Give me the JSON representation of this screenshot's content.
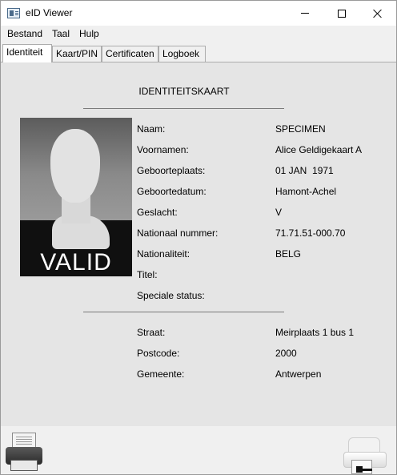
{
  "window": {
    "title": "eID Viewer",
    "controls": {
      "minimize": "minimize-icon",
      "maximize": "maximize-icon",
      "close": "close-icon"
    }
  },
  "menu": {
    "items": [
      {
        "label": "Bestand"
      },
      {
        "label": "Taal"
      },
      {
        "label": "Hulp"
      }
    ]
  },
  "tabs": [
    {
      "label": "Identiteit",
      "active": true
    },
    {
      "label": "Kaart/PIN",
      "active": false
    },
    {
      "label": "Certificaten",
      "active": false
    },
    {
      "label": "Logboek",
      "active": false
    }
  ],
  "card": {
    "title": "IDENTITEITSKAART",
    "photo_overlay": "VALID"
  },
  "identity_fields": [
    {
      "label": "Naam:",
      "value": "SPECIMEN"
    },
    {
      "label": "Voornamen:",
      "value": "Alice Geldigekaart A"
    },
    {
      "label": "Geboorteplaats:",
      "value": "01 JAN  1971"
    },
    {
      "label": "Geboortedatum:",
      "value": "Hamont-Achel"
    },
    {
      "label": "Geslacht:",
      "value": "V"
    },
    {
      "label": "Nationaal nummer:",
      "value": "71.71.51-000.70"
    },
    {
      "label": "Nationaliteit:",
      "value": "BELG"
    },
    {
      "label": "Titel:",
      "value": ""
    },
    {
      "label": "Speciale status:",
      "value": ""
    }
  ],
  "address_fields": [
    {
      "label": "Straat:",
      "value": "Meirplaats 1 bus 1"
    },
    {
      "label": "Postcode:",
      "value": "2000"
    },
    {
      "label": "Gemeente:",
      "value": "Antwerpen"
    }
  ],
  "toolbar": {
    "print_icon": "printer-icon",
    "reader_icon": "card-reader-icon"
  }
}
